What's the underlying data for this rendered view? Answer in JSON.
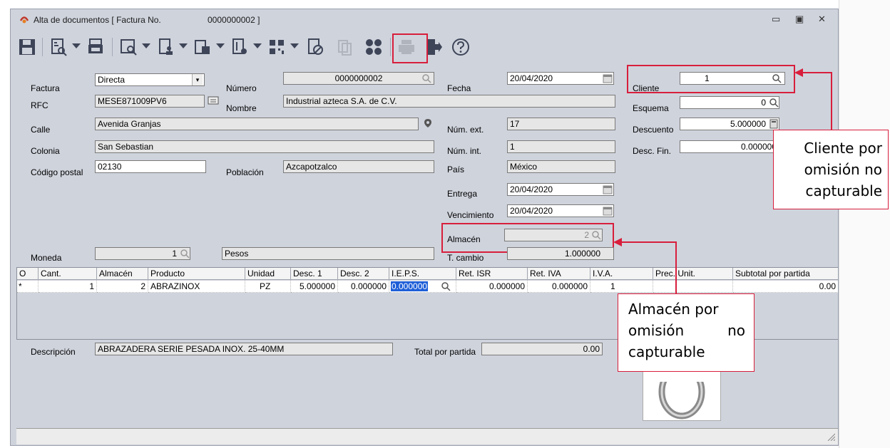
{
  "window": {
    "title": "Alta de documentos [ Factura No.",
    "title_number": "0000000002 ]",
    "controls": {
      "minimize": "▭",
      "maximize": "▣",
      "close": "✕"
    }
  },
  "toolbar": {
    "icons": [
      "save-icon",
      "preview-icon",
      "print-preview-icon",
      "document-search-icon",
      "user-doc-icon",
      "table-doc-icon",
      "file-list-icon",
      "qr-code-icon",
      "cancel-document-icon",
      "copy-icon",
      "apps-icon",
      "printer-icon",
      "exit-icon",
      "help-icon"
    ]
  },
  "form": {
    "factura_label": "Factura",
    "factura_value": "Directa",
    "numero_label": "Número",
    "numero_value": "0000000002",
    "fecha_label": "Fecha",
    "fecha_value": "20/04/2020",
    "cliente_label": "Cliente",
    "cliente_value": "1",
    "rfc_label": "RFC",
    "rfc_value": "MESE871009PV6",
    "nombre_label": "Nombre",
    "nombre_value": "Industrial azteca S.A. de C.V.",
    "esquema_label": "Esquema",
    "esquema_value": "0",
    "calle_label": "Calle",
    "calle_value": "Avenida Granjas",
    "num_ext_label": "Núm. ext.",
    "num_ext_value": "17",
    "descuento_label": "Descuento",
    "descuento_value": "5.000000",
    "colonia_label": "Colonia",
    "colonia_value": "San Sebastian",
    "num_int_label": "Núm. int.",
    "num_int_value": "1",
    "desc_fin_label": "Desc. Fin.",
    "desc_fin_value": "0.000000",
    "cp_label": "Código postal",
    "cp_value": "02130",
    "poblacion_label": "Población",
    "poblacion_value": "Azcapotzalco",
    "pais_label": "País",
    "pais_value": "México",
    "entrega_label": "Entrega",
    "entrega_value": "20/04/2020",
    "vencimiento_label": "Vencimiento",
    "vencimiento_value": "20/04/2020",
    "almacen_label": "Almacén",
    "almacen_value": "2",
    "moneda_label": "Moneda",
    "moneda_value": "1",
    "moneda_name": "Pesos",
    "tcambio_label": "T. cambio",
    "tcambio_value": "1.000000"
  },
  "grid": {
    "columns": [
      "O",
      "Cant.",
      "Almacén",
      "Producto",
      "Unidad",
      "Desc. 1",
      "Desc. 2",
      "I.E.P.S.",
      "Ret. ISR",
      "Ret. IVA",
      "I.V.A.",
      "Prec. Unit.",
      "Subtotal por partida"
    ],
    "row": {
      "marker": "*",
      "cant": "1",
      "almacen": "2",
      "producto": "ABRAZINOX",
      "unidad": "PZ",
      "desc1": "5.000000",
      "desc2": "0.000000",
      "ieps": "0.000000",
      "ret_isr": "0.000000",
      "ret_iva": "0.000000",
      "iva": "1",
      "subtotal": "0.00"
    }
  },
  "detail": {
    "descripcion_label": "Descripción",
    "descripcion_value": "ABRAZADERA SERIE PESADA INOX. 25-40MM",
    "total_label": "Total por partida",
    "total_value": "0.00"
  },
  "callouts": {
    "cliente_line1": "Cliente por",
    "cliente_line2": "omisión no",
    "cliente_line3": "capturable",
    "almacen_line1": "Almacén por",
    "almacen_line2": "omisión no",
    "almacen_line3": "capturable"
  },
  "colors": {
    "highlight": "#d81e3c",
    "window_bg": "#cfd3dc",
    "selection": "#1e5fd8"
  }
}
